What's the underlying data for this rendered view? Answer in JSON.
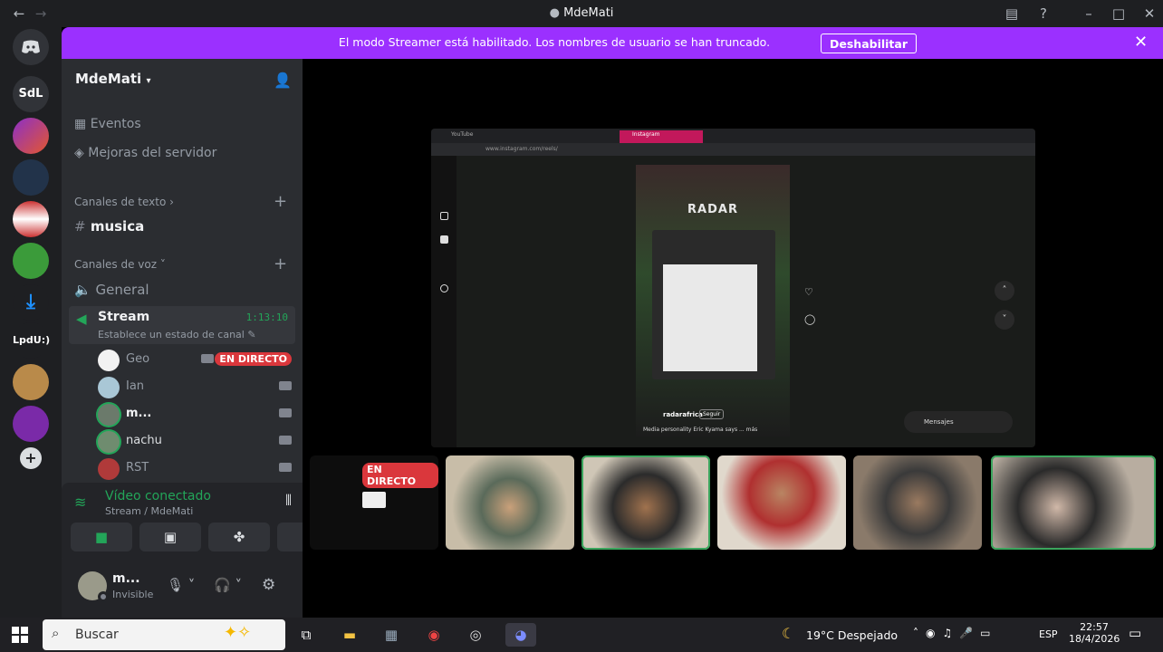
{
  "window": {
    "title": "MdeMati"
  },
  "banner": {
    "message": "El modo Streamer está habilitado. Los nombres de usuario se han truncado.",
    "button_label": "Deshabilitar"
  },
  "rail": {
    "servers": [
      "SdL",
      "LpdU:)"
    ]
  },
  "server": {
    "name": "MdeMati"
  },
  "sidebar": {
    "events": "Eventos",
    "boosts": "Mejoras del servidor",
    "text_category": "Canales de texto",
    "text_channel": "musica",
    "voice_category": "Canales de voz",
    "voice_general": "General",
    "voice_stream": "Stream",
    "stream_time": "1:13:10",
    "stream_status": "Establece un estado de canal",
    "users": [
      {
        "name": "Geo",
        "live": "EN DIRECTO"
      },
      {
        "name": "Ian"
      },
      {
        "name": "m..."
      },
      {
        "name": "nachu"
      },
      {
        "name": "RST"
      }
    ]
  },
  "voice_panel": {
    "status": "Vídeo conectado",
    "channel": "Stream / MdeMati"
  },
  "user_panel": {
    "name": "m...",
    "status": "Invisible"
  },
  "stage": {
    "live_badge": "EN DIRECTO",
    "screen": {
      "tabs": [
        "YouTube",
        "Instagram"
      ],
      "url": "www.instagram.com/reels/",
      "post_brand": "RADAR",
      "post_user": "radarafrica",
      "follow": "Seguir",
      "caption": "Media personality Eric Kyama says ... más",
      "messages": "Mensajes"
    }
  },
  "taskbar": {
    "search_placeholder": "Buscar",
    "weather": "19°C  Despejado",
    "lang": "ESP",
    "time": "22:57",
    "date": "18/4/2026"
  },
  "colors": {
    "accent": "#9b30ff",
    "live": "#da373c",
    "connected": "#23a559",
    "speaking": "#3ba55d"
  }
}
